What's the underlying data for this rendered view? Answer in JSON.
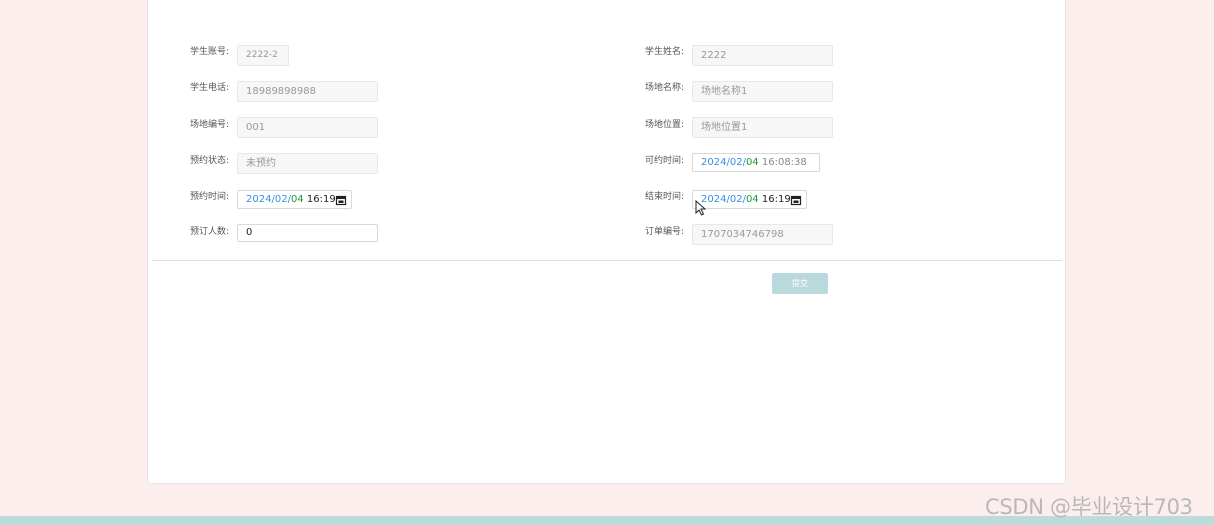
{
  "form": {
    "student_account": {
      "label": "学生账号:",
      "value": "2222-2"
    },
    "student_name": {
      "label": "学生姓名:",
      "value": "2222"
    },
    "student_phone": {
      "label": "学生电话:",
      "value": "18989898988"
    },
    "venue_name": {
      "label": "场地名称:",
      "value": "场地名称1"
    },
    "venue_number": {
      "label": "场地编号:",
      "value": "001"
    },
    "venue_location": {
      "label": "场地位置:",
      "value": "场地位置1"
    },
    "booking_status": {
      "label": "预约状态:",
      "value": "未预约"
    },
    "available_time": {
      "label": "可约时间:",
      "year": "2024",
      "month": "02",
      "day": "04",
      "time": "16:08:38"
    },
    "booking_time": {
      "label": "预约时间:",
      "year": "2024",
      "month": "02",
      "day": "04",
      "time": "16:19"
    },
    "end_time": {
      "label": "结束时间:",
      "year": "2024",
      "month": "02",
      "day": "04",
      "time": "16:19"
    },
    "people_count": {
      "label": "预订人数:",
      "value": "0"
    },
    "order_number": {
      "label": "订单编号:",
      "value": "1707034746798"
    },
    "submit_label": "提交"
  },
  "watermark": "CSDN @毕业设计703",
  "colors": {
    "page_background": "#fdeeee",
    "panel_background": "#ffffff",
    "bottom_bar": "#bcdcdc",
    "submit_button": "#b9d9dc",
    "date_blue": "#3a8ee6",
    "date_green": "#1a9a3a"
  }
}
